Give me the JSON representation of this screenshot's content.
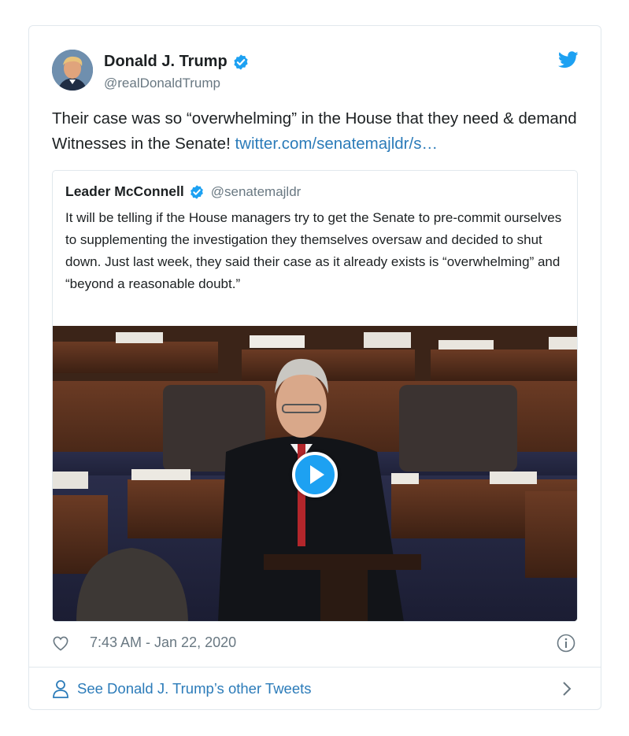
{
  "tweet": {
    "author_name": "Donald J. Trump",
    "author_handle": "@realDonaldTrump",
    "text_before_link": "Their case was so “overwhelming” in the House that they need & demand Witnesses in the Senate! ",
    "link_text": "twitter.com/senatemajldr/s…",
    "timestamp": "7:43 AM - Jan 22, 2020",
    "icons": {
      "verified": "verified-badge-icon",
      "brand": "twitter-bird-icon",
      "like": "heart-icon",
      "info": "info-icon"
    }
  },
  "quoted_tweet": {
    "author_name": "Leader McConnell",
    "author_handle": "@senatemajldr",
    "text": "It will be telling if the House managers try to get the Senate to pre-commit ourselves to supplementing the investigation they themselves oversaw and decided to shut down. Just last week, they said their case as it already exists is “overwhelming” and “beyond a reasonable doubt.”",
    "media": {
      "type": "video",
      "icon": "play-icon"
    }
  },
  "footer": {
    "link_text": "See Donald J. Trump’s other Tweets",
    "icons": {
      "person": "person-icon",
      "chevron": "chevron-right-icon"
    }
  },
  "colors": {
    "link": "#2b7bb9",
    "brand_blue": "#1da1f2",
    "secondary_text": "#697882",
    "border": "#e1e8ed"
  }
}
